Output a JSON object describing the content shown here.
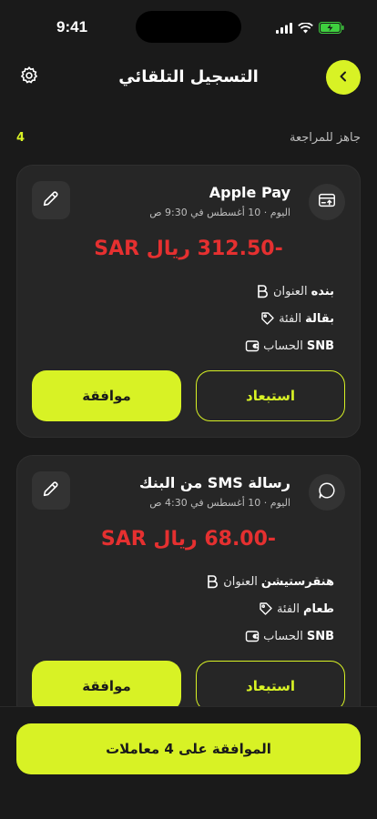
{
  "status_bar": {
    "time": "9:41"
  },
  "header": {
    "title": "التسجيل التلقائي"
  },
  "section": {
    "label": "جاهز للمراجعة",
    "count": "4"
  },
  "transactions": [
    {
      "name": "Apple Pay",
      "date": "اليوم · 10 أغسطس في 9:30 ص",
      "amount": "-312.50 ريال SAR",
      "details": {
        "payee_label": "العنوان",
        "payee_value": "بنده",
        "category_label": "الفئة",
        "category_value": "بقالة",
        "account_label": "الحساب",
        "account_value": "SNB"
      },
      "approve_label": "موافقة",
      "reject_label": "استبعاد"
    },
    {
      "name": "رسالة SMS من البنك",
      "date": "اليوم · 10 أغسطس في 4:30 ص",
      "amount": "-68.00 ريال SAR",
      "details": {
        "payee_label": "العنوان",
        "payee_value": "هنقرستيشن",
        "category_label": "الفئة",
        "category_value": "طعام",
        "account_label": "الحساب",
        "account_value": "SNB"
      },
      "approve_label": "موافقة",
      "reject_label": "استبعاد"
    }
  ],
  "bottom": {
    "approve_all_label": "الموافقة على 4 معاملات"
  },
  "colors": {
    "accent": "#d8f225",
    "negative": "#e53030",
    "background": "#1a1a1a",
    "card": "#262626"
  }
}
